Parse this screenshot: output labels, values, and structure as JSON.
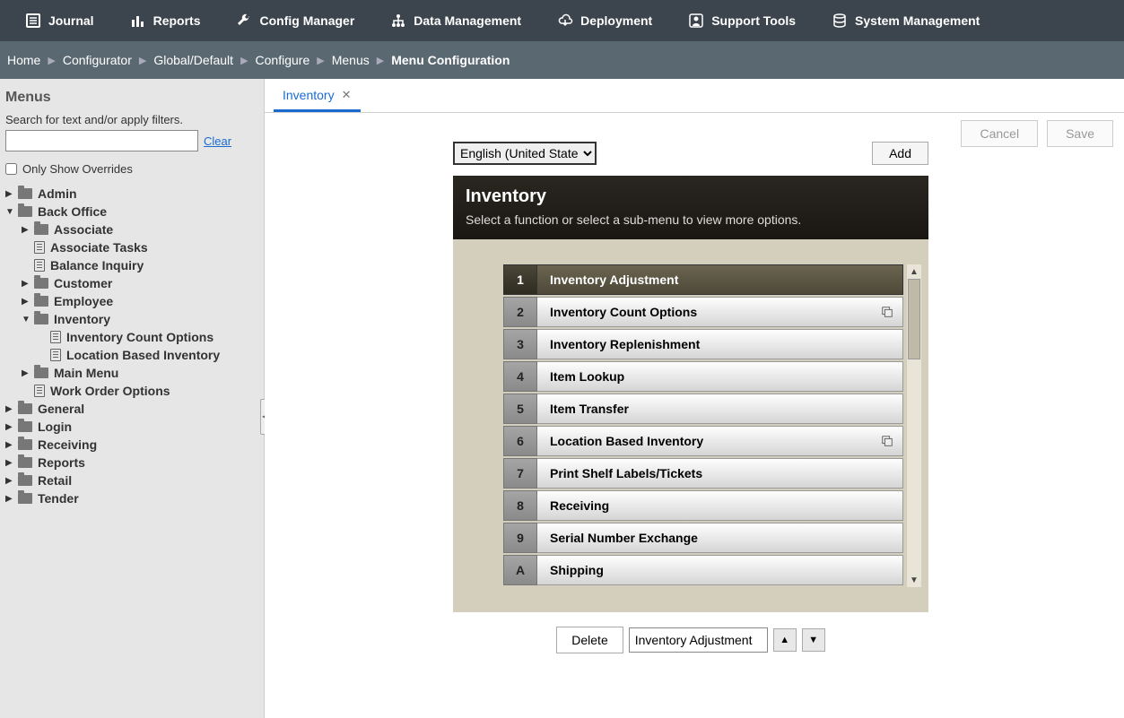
{
  "topnav": [
    {
      "icon": "journal",
      "label": "Journal"
    },
    {
      "icon": "reports",
      "label": "Reports"
    },
    {
      "icon": "config",
      "label": "Config Manager"
    },
    {
      "icon": "data",
      "label": "Data Management"
    },
    {
      "icon": "deploy",
      "label": "Deployment"
    },
    {
      "icon": "support",
      "label": "Support Tools"
    },
    {
      "icon": "system",
      "label": "System Management"
    }
  ],
  "breadcrumb": [
    "Home",
    "Configurator",
    "Global/Default",
    "Configure",
    "Menus",
    "Menu Configuration"
  ],
  "sidebar": {
    "title": "Menus",
    "search_label": "Search for text and/or apply filters.",
    "search_value": "",
    "clear": "Clear",
    "override_label": "Only Show Overrides",
    "tree": [
      {
        "type": "folder",
        "label": "Admin",
        "indent": 0,
        "arrow": "▶"
      },
      {
        "type": "folder",
        "label": "Back Office",
        "indent": 0,
        "arrow": "▼"
      },
      {
        "type": "folder",
        "label": "Associate",
        "indent": 1,
        "arrow": "▶"
      },
      {
        "type": "file",
        "label": "Associate Tasks",
        "indent": 1
      },
      {
        "type": "file",
        "label": "Balance Inquiry",
        "indent": 1
      },
      {
        "type": "folder",
        "label": "Customer",
        "indent": 1,
        "arrow": "▶"
      },
      {
        "type": "folder",
        "label": "Employee",
        "indent": 1,
        "arrow": "▶"
      },
      {
        "type": "folder",
        "label": "Inventory",
        "indent": 1,
        "arrow": "▼"
      },
      {
        "type": "file",
        "label": "Inventory Count Options",
        "indent": 2
      },
      {
        "type": "file",
        "label": "Location Based Inventory",
        "indent": 2
      },
      {
        "type": "folder",
        "label": "Main Menu",
        "indent": 1,
        "arrow": "▶"
      },
      {
        "type": "file",
        "label": "Work Order Options",
        "indent": 1
      },
      {
        "type": "folder",
        "label": "General",
        "indent": 0,
        "arrow": "▶"
      },
      {
        "type": "folder",
        "label": "Login",
        "indent": 0,
        "arrow": "▶"
      },
      {
        "type": "folder",
        "label": "Receiving",
        "indent": 0,
        "arrow": "▶"
      },
      {
        "type": "folder",
        "label": "Reports",
        "indent": 0,
        "arrow": "▶"
      },
      {
        "type": "folder",
        "label": "Retail",
        "indent": 0,
        "arrow": "▶"
      },
      {
        "type": "folder",
        "label": "Tender",
        "indent": 0,
        "arrow": "▶"
      }
    ]
  },
  "tab": {
    "label": "Inventory"
  },
  "actions": {
    "cancel": "Cancel",
    "save": "Save"
  },
  "lang_select": "English (United States)",
  "add_button": "Add",
  "panel": {
    "title": "Inventory",
    "subtitle": "Select a function or select a sub-menu to view more options."
  },
  "menu_items": [
    {
      "num": "1",
      "label": "Inventory Adjustment",
      "selected": true,
      "sub": false
    },
    {
      "num": "2",
      "label": "Inventory Count Options",
      "selected": false,
      "sub": true
    },
    {
      "num": "3",
      "label": "Inventory Replenishment",
      "selected": false,
      "sub": false
    },
    {
      "num": "4",
      "label": "Item Lookup",
      "selected": false,
      "sub": false
    },
    {
      "num": "5",
      "label": "Item Transfer",
      "selected": false,
      "sub": false
    },
    {
      "num": "6",
      "label": "Location Based Inventory",
      "selected": false,
      "sub": true
    },
    {
      "num": "7",
      "label": "Print Shelf Labels/Tickets",
      "selected": false,
      "sub": false
    },
    {
      "num": "8",
      "label": "Receiving",
      "selected": false,
      "sub": false
    },
    {
      "num": "9",
      "label": "Serial Number Exchange",
      "selected": false,
      "sub": false
    },
    {
      "num": "A",
      "label": "Shipping",
      "selected": false,
      "sub": false
    }
  ],
  "footer": {
    "delete": "Delete",
    "selected_value": "Inventory Adjustment"
  }
}
